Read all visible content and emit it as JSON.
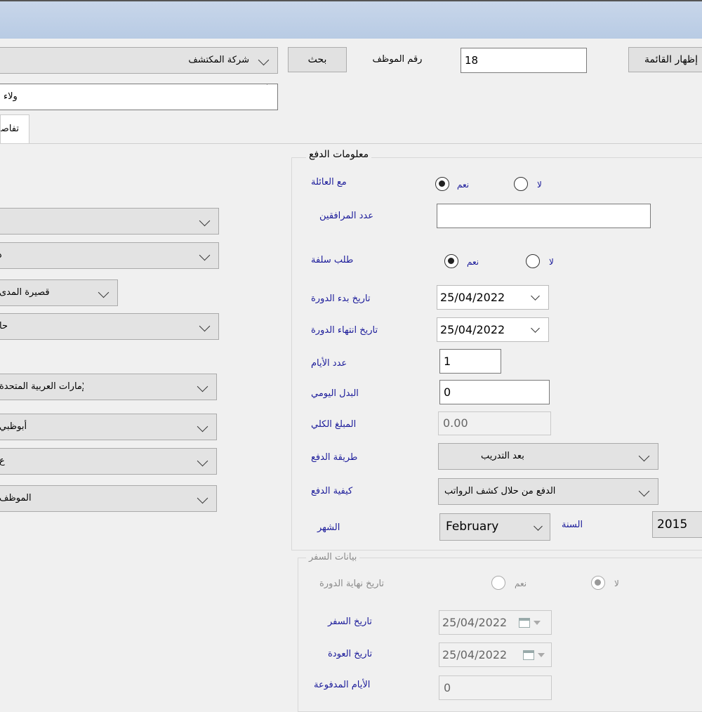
{
  "header": {
    "company": "شركة المكتشف ",
    "search_label": "بحث",
    "employee_no_label": "رقم الموظف",
    "employee_no_value": "18",
    "show_list_label": "إظهار القائمة",
    "second_combo": "ولاء"
  },
  "tab": {
    "label": "تفاصيل"
  },
  "left_combos": [
    "",
    "دائم",
    "قصيرة المدى",
    "حا",
    "الإمارات العربية المتحدة",
    "أبوظبي",
    "ع",
    "الموظف"
  ],
  "payment": {
    "title": "معلومات الدفع",
    "with_family_label": "مع العائلة",
    "yes": "نعم",
    "no": "لا",
    "companions_label": "عدد المرافقين",
    "companions_value": "",
    "advance_label": "طلب سلفة",
    "start_label": "تاريخ بدء الدورة",
    "start_value": "25/04/2022",
    "end_label": "تاريخ انتهاء الدورة",
    "end_value": "25/04/2022",
    "days_label": "عدد الأيام",
    "days_value": "1",
    "daily_label": "البدل اليومي",
    "daily_value": "0",
    "total_label": "المبلغ الكلي",
    "total_value": "0.00",
    "method_label": "طريقة الدفع",
    "method_value": "بعد التدريب",
    "how_label": "كيفية الدفع",
    "how_value": "الدفع من حلال كشف الرواتب",
    "month_label": "الشهر",
    "month_value": "February",
    "year_label": "السنة",
    "year_value": "2015"
  },
  "travel": {
    "title": "بيانات السفر",
    "end_course_label": "تاريخ نهاية الدورة",
    "yes": "نعم",
    "no": "لا",
    "travel_date_label": "تاريخ السفر",
    "travel_date_value": "25/04/2022",
    "return_date_label": "تاريخ العودة",
    "return_date_value": "25/04/2022",
    "paid_days_label": "الأيام المدفوعة",
    "paid_days_value": "0"
  }
}
